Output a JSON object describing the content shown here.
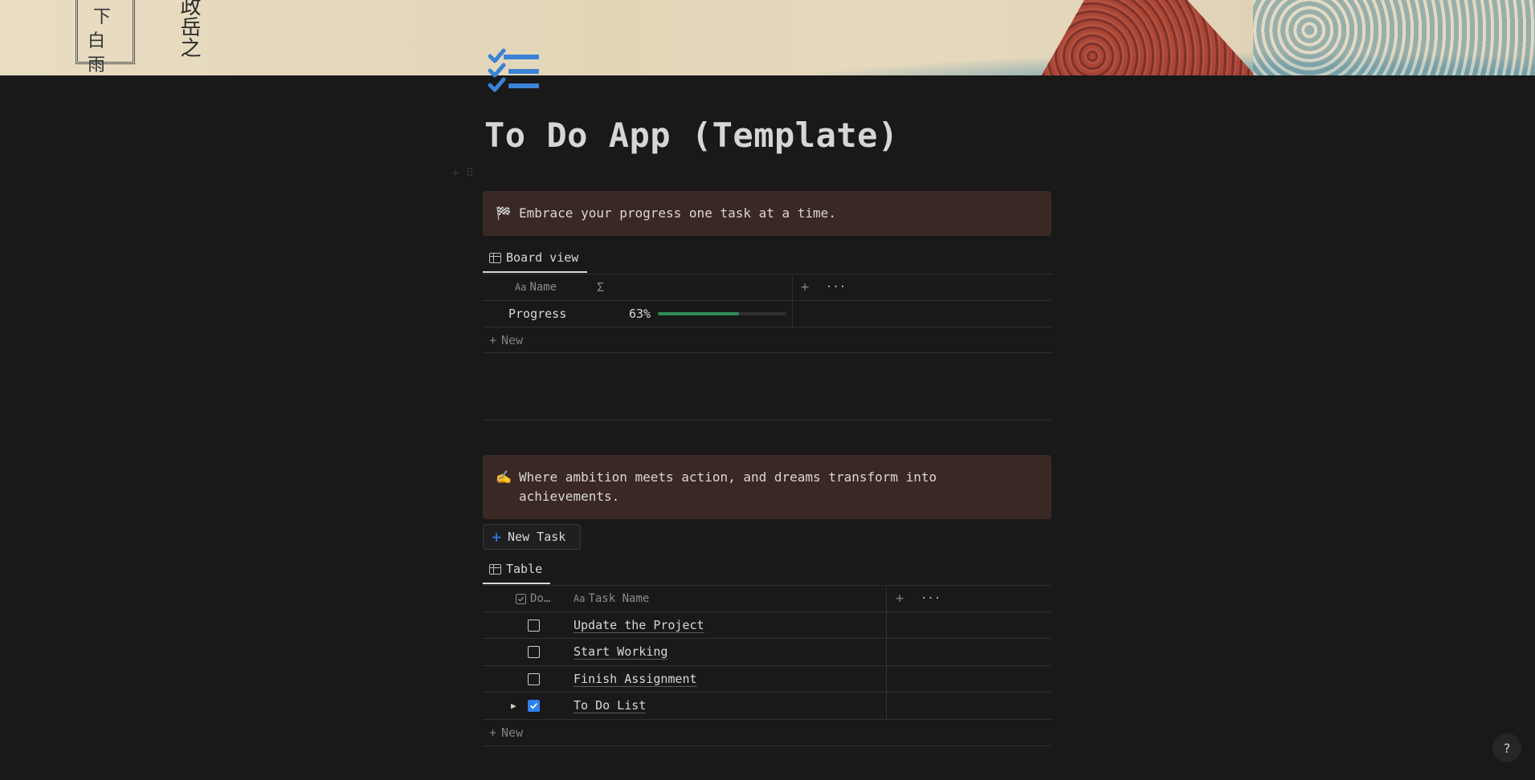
{
  "page": {
    "title": "To Do App (Template)"
  },
  "callout1": {
    "emoji": "🏁",
    "text": "Embrace your progress one task at a time."
  },
  "board": {
    "tab_label": "Board view",
    "columns": {
      "name": "Name",
      "formula": "Σ"
    },
    "rows": [
      {
        "name": "Progress",
        "percent_label": "63%",
        "percent_value": 63
      }
    ],
    "new_label": "New",
    "add_label": "+",
    "more_label": "···"
  },
  "callout2": {
    "emoji": "✍️",
    "text": "Where ambition meets action, and dreams transform into achievements."
  },
  "new_task_button": {
    "label": "New Task",
    "icon": "+"
  },
  "table": {
    "tab_label": "Table",
    "columns": {
      "done": "Do…",
      "task_name": "Task Name"
    },
    "name_prefix": "Aa",
    "rows": [
      {
        "done": false,
        "name": "Update the Project",
        "expandable": false
      },
      {
        "done": false,
        "name": "Start Working",
        "expandable": false
      },
      {
        "done": false,
        "name": "Finish Assignment",
        "expandable": false
      },
      {
        "done": true,
        "name": "To Do List",
        "expandable": true
      }
    ],
    "new_label": "New",
    "add_label": "+",
    "more_label": "···"
  },
  "help": {
    "label": "?"
  },
  "colors": {
    "background": "#191919",
    "callout_bg": "#3a2824",
    "accent_blue": "#2f80ed",
    "progress_green": "#2e8b57"
  },
  "icons": {
    "page_icon": "checklist-icon",
    "table_tab": "table-icon"
  }
}
